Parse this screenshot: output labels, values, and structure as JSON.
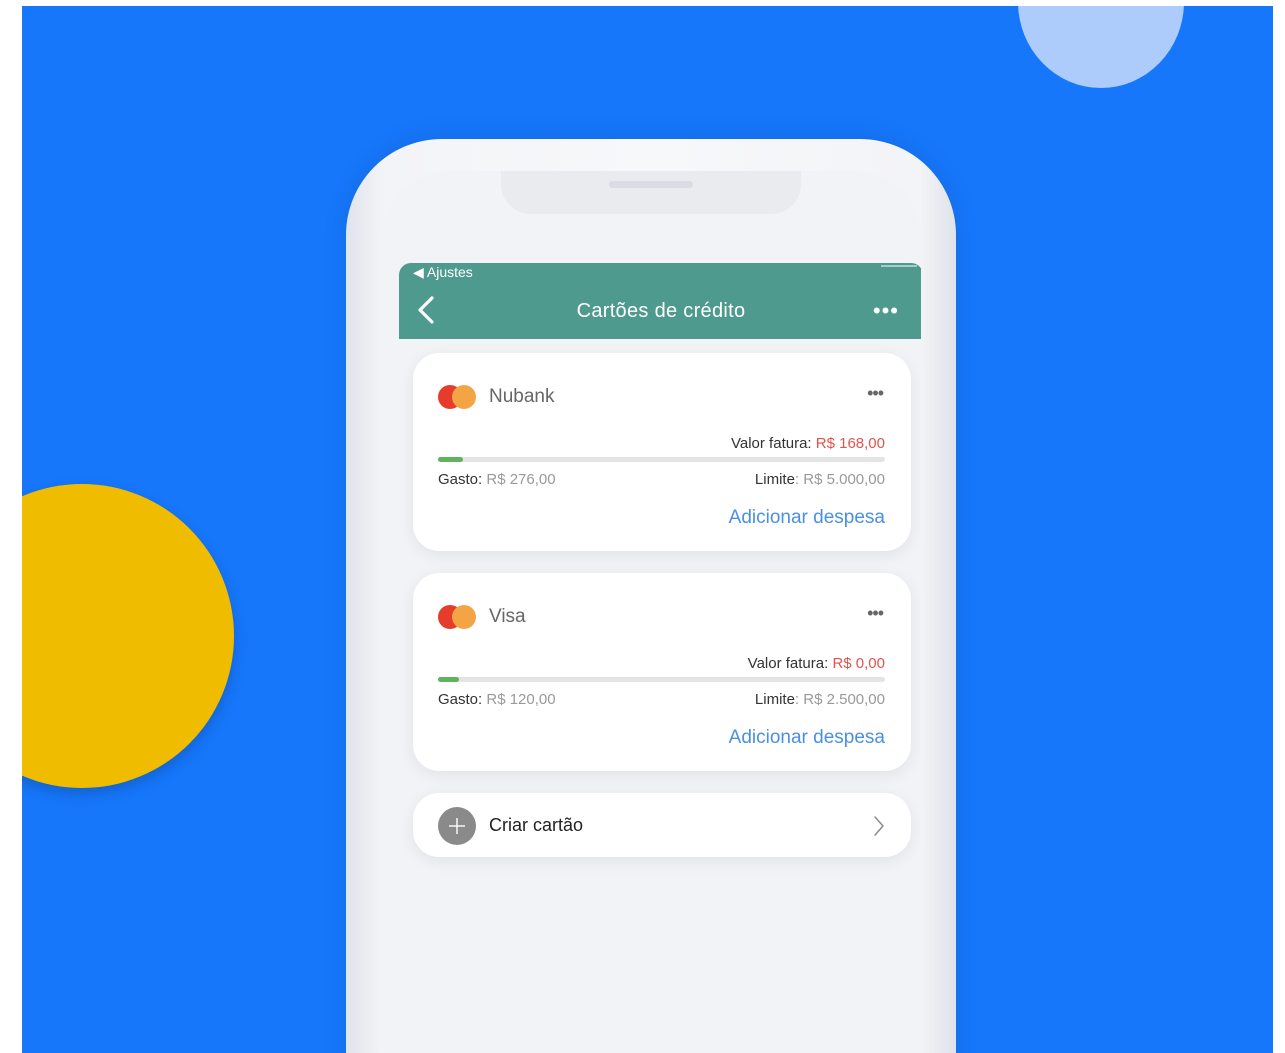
{
  "status_bar": {
    "back_app": "◀ Ajustes"
  },
  "header": {
    "title": "Cartões de crédito",
    "more": "•••"
  },
  "cards": [
    {
      "name": "Nubank",
      "more": "•••",
      "valor_label": "Valor fatura:",
      "valor_value": "R$ 168,00",
      "gasto_label": "Gasto:",
      "gasto_value": "R$ 276,00",
      "limite_label": "Limite",
      "limite_value": ": R$ 5.000,00",
      "usage_fraction": 0.055,
      "add_label": "Adicionar despesa"
    },
    {
      "name": "Visa",
      "more": "•••",
      "valor_label": "Valor fatura:",
      "valor_value": "R$ 0,00",
      "gasto_label": "Gasto:",
      "gasto_value": "R$ 120,00",
      "limite_label": "Limite",
      "limite_value": ": R$ 2.500,00",
      "usage_fraction": 0.048,
      "add_label": "Adicionar despesa"
    }
  ],
  "create_card": {
    "label": "Criar cartão"
  },
  "colors": {
    "background": "#1677fb",
    "header": "#4f9a8e",
    "accent_yellow": "#f0bc00",
    "link_blue": "#4a90e2",
    "amount_red": "#e0544c",
    "progress_green": "#5fb35f"
  }
}
